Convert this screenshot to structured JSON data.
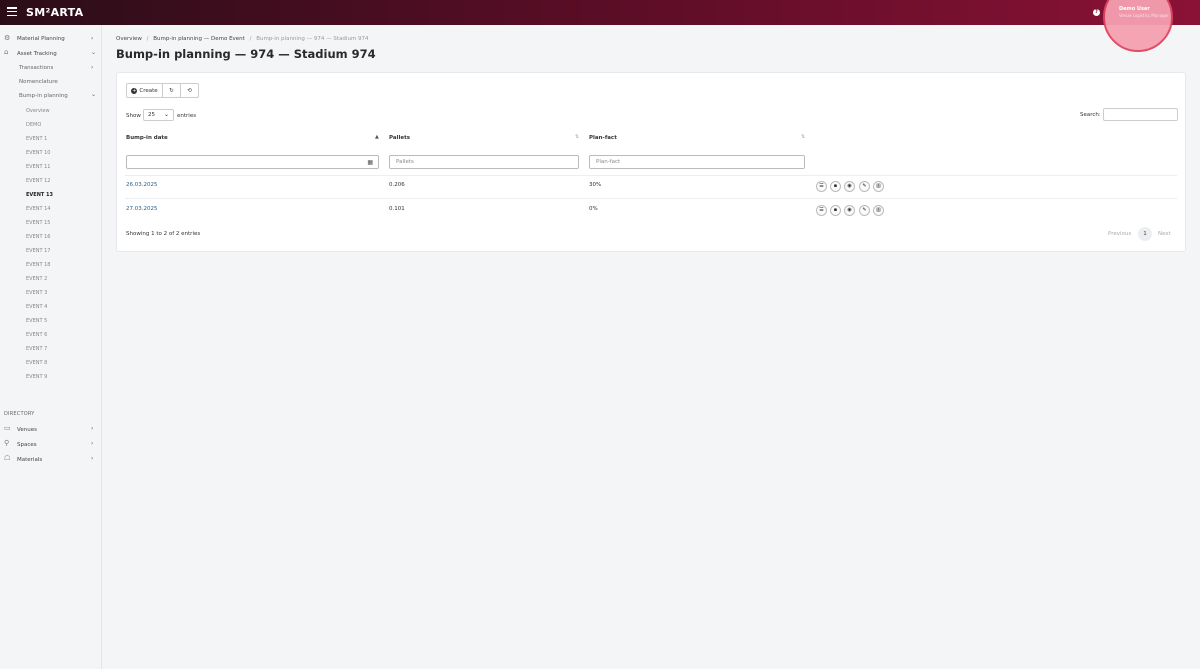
{
  "app": {
    "logo": "SM²ARTA",
    "help": "?"
  },
  "user": {
    "name": "Demo User",
    "role": "Venue Logistics Manager"
  },
  "sidebar": {
    "material_planning": "Material Planning",
    "asset_tracking": "Asset Tracking",
    "transactions": "Transactions",
    "nomenclature": "Nomenclature",
    "bump_in_planning": "Bump-in planning",
    "overview": "Overview",
    "events": [
      "DEMO",
      "EVENT 1",
      "EVENT 10",
      "EVENT 11",
      "EVENT 12",
      "EVENT 13",
      "EVENT 14",
      "EVENT 15",
      "EVENT 16",
      "EVENT 17",
      "EVENT 18",
      "EVENT 2",
      "EVENT 3",
      "EVENT 4",
      "EVENT 5",
      "EVENT 6",
      "EVENT 7",
      "EVENT 8",
      "EVENT 9"
    ],
    "active_event": "EVENT 13",
    "directory_label": "DIRECTORY",
    "venues": "Venues",
    "spaces": "Spaces",
    "materials": "Materials"
  },
  "breadcrumb": {
    "item1": "Overview",
    "item2": "Bump-in planning — Demo Event",
    "current": "Bump-in planning — 974 — Stadium 974",
    "separator": "/"
  },
  "page_title": "Bump-in planning — 974 — Stadium 974",
  "toolbar": {
    "create_label": "Create"
  },
  "table_controls": {
    "show_label": "Show",
    "page_size": "25",
    "entries_label": "entries",
    "search_label": "Search:"
  },
  "table": {
    "columns": [
      "Bump-in date",
      "Pallets",
      "Plan-fact"
    ],
    "filter_placeholders": {
      "pallets": "Pallets",
      "plan_fact": "Plan-fact"
    },
    "rows": [
      {
        "date": "26.03.2025",
        "pallets": "0.206",
        "plan_fact": "30%"
      },
      {
        "date": "27.03.2025",
        "pallets": "0.101",
        "plan_fact": "0%"
      }
    ]
  },
  "footer": {
    "info": "Showing 1 to 2 of 2 entries",
    "previous": "Previous",
    "page": "1",
    "next": "Next"
  }
}
